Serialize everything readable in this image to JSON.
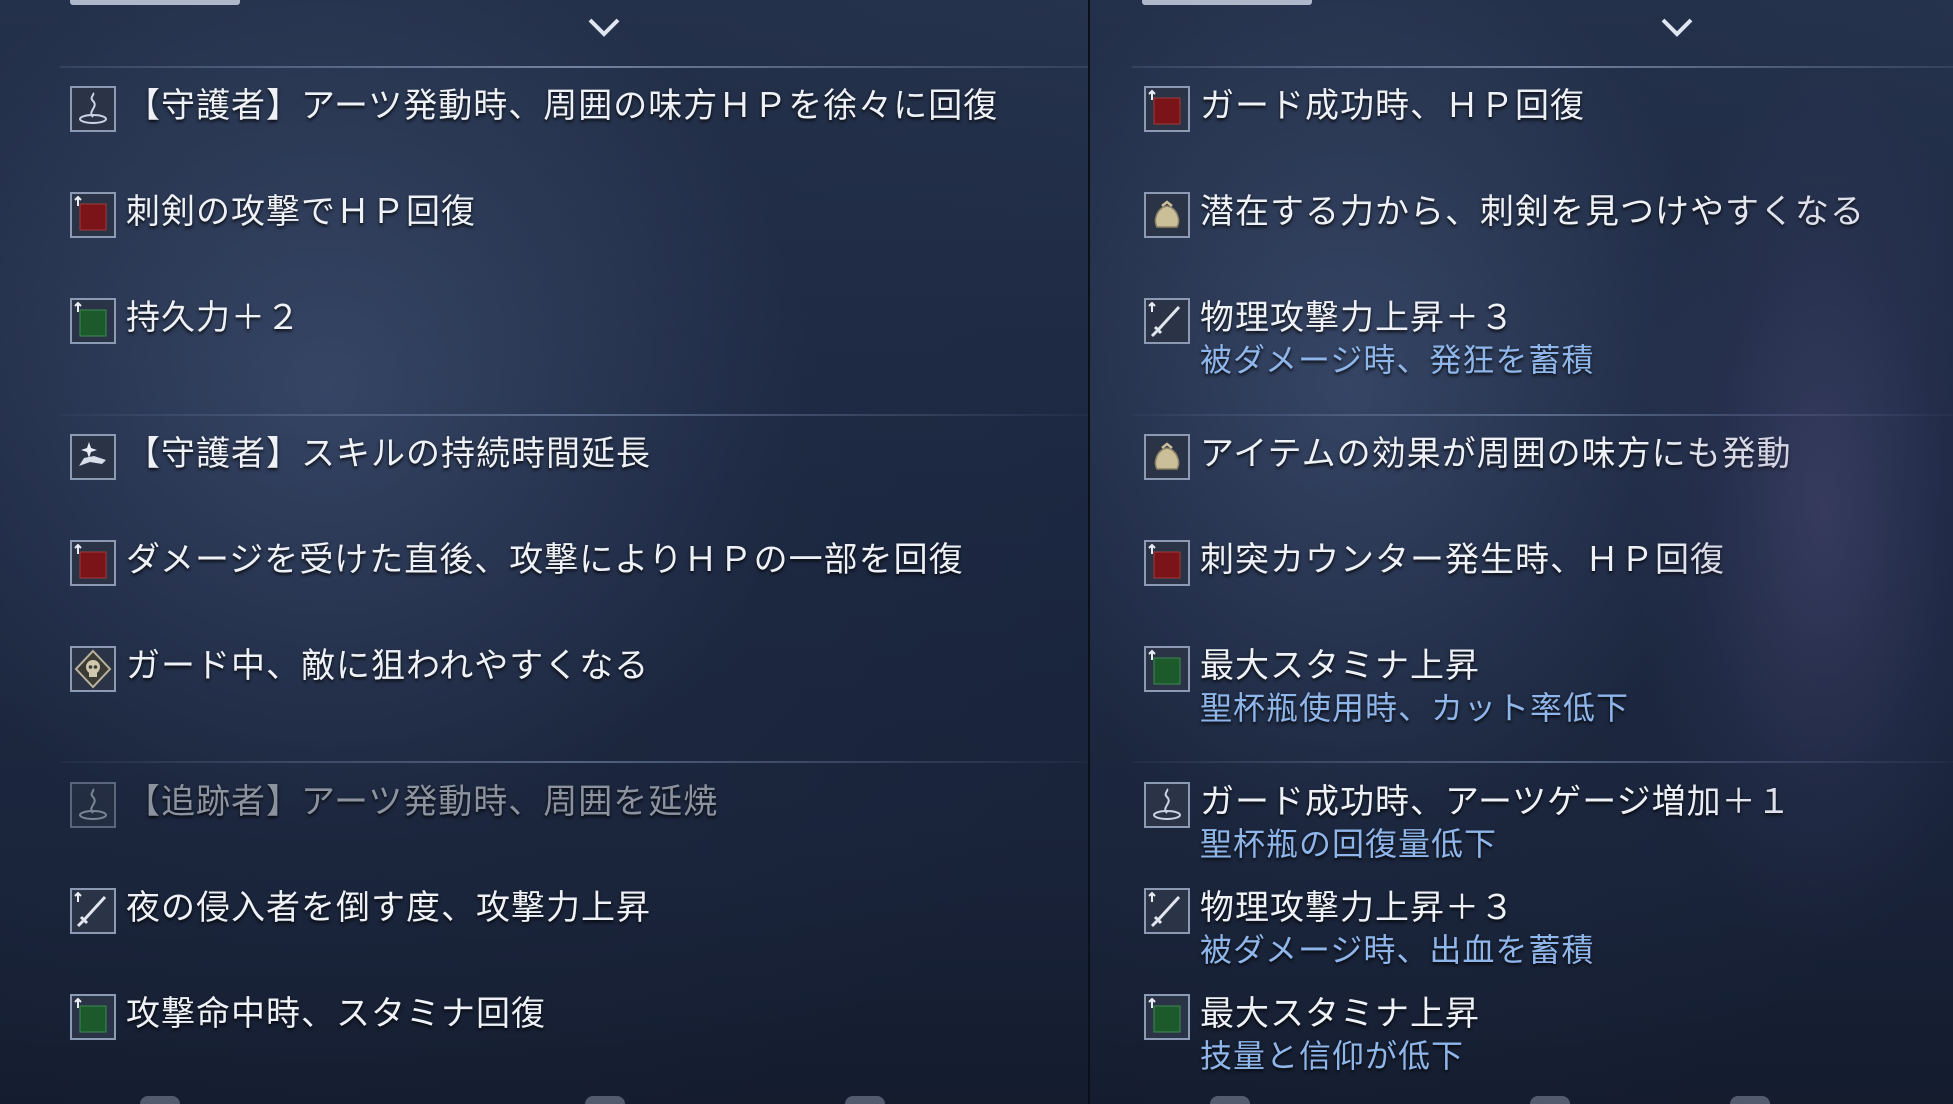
{
  "left": {
    "items": [
      {
        "icon": "fountain-icon",
        "line1": "【守護者】アーツ発動時、周囲の味方ＨＰを徐々に回復",
        "line2": ""
      },
      {
        "icon": "red-square-icon",
        "line1": "刺剣の攻撃でＨＰ回復",
        "line2": ""
      },
      {
        "icon": "green-square-icon",
        "line1": "持久力＋２",
        "line2": ""
      },
      {
        "icon": "hand-sparkle-icon",
        "line1": "【守護者】スキルの持続時間延長",
        "line2": ""
      },
      {
        "icon": "red-square-icon",
        "line1": "ダメージを受けた直後、攻撃によりＨＰの一部を回復",
        "line2": ""
      },
      {
        "icon": "skull-diamond-icon",
        "line1": "ガード中、敵に狙われやすくなる",
        "line2": ""
      },
      {
        "icon": "fountain-icon",
        "line1": "【追跡者】アーツ発動時、周囲を延焼",
        "line2": ""
      },
      {
        "icon": "sword-icon",
        "line1": "夜の侵入者を倒す度、攻撃力上昇",
        "line2": ""
      },
      {
        "icon": "green-square-icon",
        "line1": "攻撃命中時、スタミナ回復",
        "line2": ""
      }
    ]
  },
  "right": {
    "items": [
      {
        "icon": "red-square-icon",
        "line1": "ガード成功時、ＨＰ回復",
        "line2": ""
      },
      {
        "icon": "pouch-icon",
        "line1": "潜在する力から、刺剣を見つけやすくなる",
        "line2": ""
      },
      {
        "icon": "sword-icon",
        "line1": "物理攻撃力上昇＋３",
        "line2": "被ダメージ時、発狂を蓄積"
      },
      {
        "icon": "pouch-icon",
        "line1": "アイテムの効果が周囲の味方にも発動",
        "line2": ""
      },
      {
        "icon": "red-square-icon",
        "line1": "刺突カウンター発生時、ＨＰ回復",
        "line2": ""
      },
      {
        "icon": "green-square-icon",
        "line1": "最大スタミナ上昇",
        "line2": "聖杯瓶使用時、カット率低下"
      },
      {
        "icon": "fountain-icon",
        "line1": "ガード成功時、アーツゲージ増加＋１",
        "line2": "聖杯瓶の回復量低下"
      },
      {
        "icon": "sword-icon",
        "line1": "物理攻撃力上昇＋３",
        "line2": "被ダメージ時、出血を蓄積"
      },
      {
        "icon": "green-square-icon",
        "line1": "最大スタミナ上昇",
        "line2": "技量と信仰が低下"
      }
    ]
  },
  "colors": {
    "text": "#eef1f6",
    "subtext": "#8fb6ea",
    "dim_text": "#8c939f",
    "red_icon": "#7a1418",
    "green_icon": "#1c5a2c"
  }
}
